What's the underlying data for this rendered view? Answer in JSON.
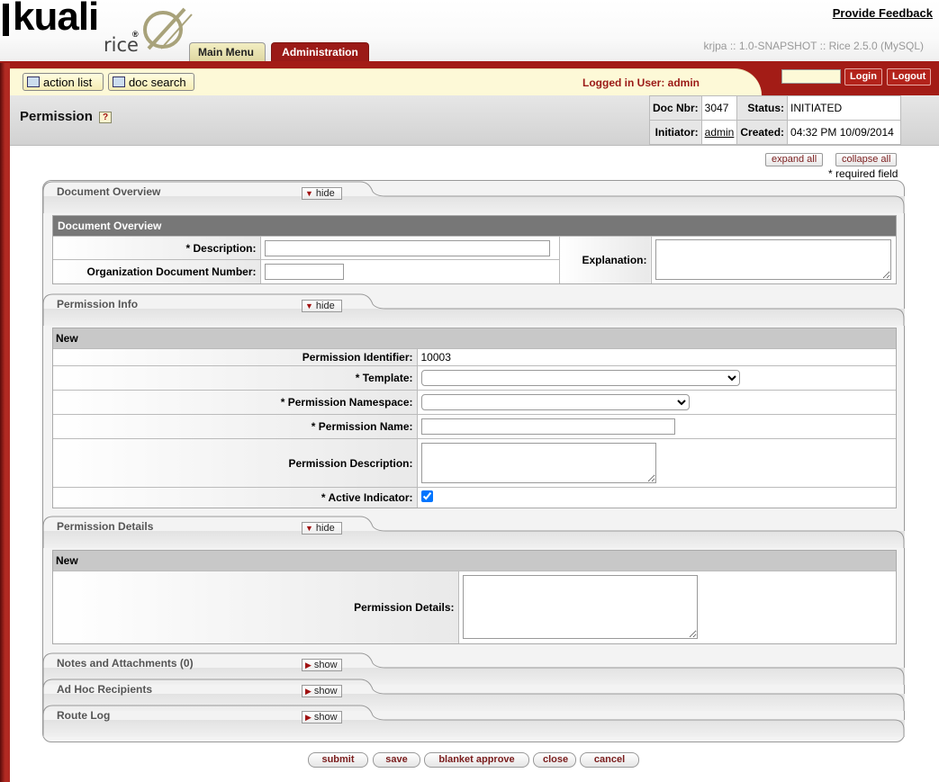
{
  "header": {
    "logo_word": "kuali",
    "logo_sub": "rice",
    "logo_reg": "®",
    "feedback": "Provide Feedback",
    "version": "krjpa :: 1.0-SNAPSHOT :: Rice 2.5.0 (MySQL)",
    "tabs": [
      {
        "label": "Main Menu",
        "active": false
      },
      {
        "label": "Administration",
        "active": true
      }
    ]
  },
  "toolbar": {
    "action_list": "action list",
    "doc_search": "doc search",
    "logged_in": "Logged in User: admin",
    "login_value": "",
    "login": "Login",
    "logout": "Logout"
  },
  "doc": {
    "title": "Permission",
    "help_glyph": "?",
    "doc_nbr_label": "Doc Nbr:",
    "doc_nbr": "3047",
    "status_label": "Status:",
    "status": "INITIATED",
    "initiator_label": "Initiator:",
    "initiator": "admin",
    "created_label": "Created:",
    "created": "04:32 PM 10/09/2014"
  },
  "controls": {
    "expand_all": "expand all",
    "collapse_all": "collapse all",
    "required_note": "* required field"
  },
  "panels": {
    "overview": {
      "tab": "Document Overview",
      "toggle": "hide",
      "section": "Document Overview",
      "description_label": "*  Description:",
      "description_value": "",
      "org_doc_label": "Organization Document Number:",
      "org_doc_value": "",
      "explanation_label": "Explanation:",
      "explanation_value": ""
    },
    "info": {
      "tab": "Permission Info",
      "toggle": "hide",
      "section": "New",
      "identifier_label": "Permission Identifier:",
      "identifier": "10003",
      "template_label": "*  Template:",
      "template_value": "",
      "namespace_label": "*  Permission Namespace:",
      "namespace_value": "",
      "name_label": "*  Permission Name:",
      "name_value": "",
      "description_label": "Permission Description:",
      "description_value": "",
      "active_label": "*  Active Indicator:",
      "active": true
    },
    "details": {
      "tab": "Permission Details",
      "toggle": "hide",
      "section": "New",
      "details_label": "Permission Details:",
      "details_value": ""
    },
    "notes": {
      "tab": "Notes and Attachments (0)",
      "toggle": "show"
    },
    "adhoc": {
      "tab": "Ad Hoc Recipients",
      "toggle": "show"
    },
    "routelog": {
      "tab": "Route Log",
      "toggle": "show"
    }
  },
  "buttons": {
    "submit": "submit",
    "save": "save",
    "blanket_approve": "blanket approve",
    "close": "close",
    "cancel": "cancel"
  },
  "colors": {
    "brand_red": "#9b1a17",
    "toolbar_yellow": "#fdf9d7",
    "section_header": "#777777"
  }
}
